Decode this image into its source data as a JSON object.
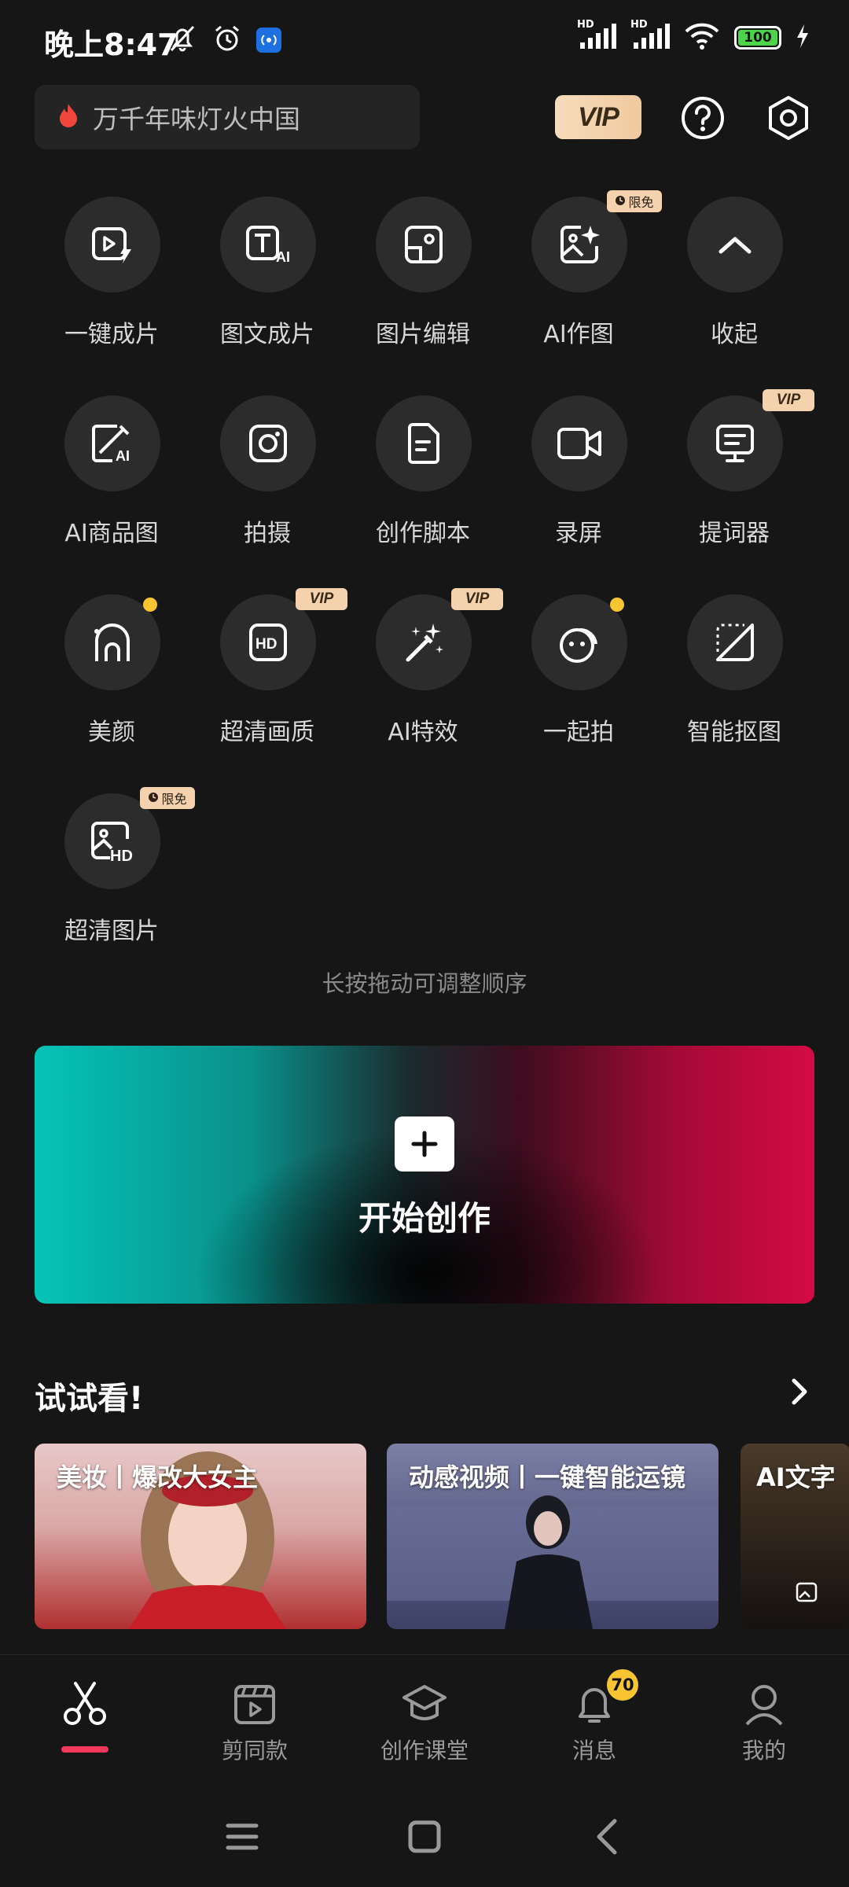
{
  "status_bar": {
    "time": "晚上8:47",
    "network_1": "HD",
    "network_2": "HD",
    "battery": "100"
  },
  "header": {
    "search_text": "万千年味灯火中国",
    "vip_label": "VIP"
  },
  "tools": [
    {
      "label": "一键成片",
      "icon": "play-flash-icon"
    },
    {
      "label": "图文成片",
      "icon": "text-ai-icon"
    },
    {
      "label": "图片编辑",
      "icon": "image-edit-icon"
    },
    {
      "label": "AI作图",
      "icon": "ai-image-icon",
      "tag": "限免"
    },
    {
      "label": "收起",
      "icon": "chevron-up-icon"
    },
    {
      "label": "AI商品图",
      "icon": "ai-product-icon"
    },
    {
      "label": "拍摄",
      "icon": "camera-icon"
    },
    {
      "label": "创作脚本",
      "icon": "script-icon"
    },
    {
      "label": "录屏",
      "icon": "screen-record-icon"
    },
    {
      "label": "提词器",
      "icon": "teleprompter-icon",
      "tag": "VIP"
    },
    {
      "label": "美颜",
      "icon": "beauty-icon"
    },
    {
      "label": "超清画质",
      "icon": "hd-quality-icon",
      "tag": "VIP"
    },
    {
      "label": "AI特效",
      "icon": "magic-wand-icon",
      "tag": "VIP"
    },
    {
      "label": "一起拍",
      "icon": "together-shoot-icon"
    },
    {
      "label": "智能抠图",
      "icon": "cutout-icon"
    },
    {
      "label": "超清图片",
      "icon": "hd-image-icon",
      "tag": "限免"
    }
  ],
  "hint": "长按拖动可调整顺序",
  "create": {
    "label": "开始创作"
  },
  "try_section": {
    "title": "试试看!",
    "cards": [
      {
        "title": "美妆丨爆改大女主"
      },
      {
        "title": "动感视频丨一键智能运镜"
      },
      {
        "title": "AI文字"
      }
    ]
  },
  "bottom_nav": [
    {
      "label": "",
      "icon": "scissors-icon",
      "active": true
    },
    {
      "label": "剪同款",
      "icon": "template-icon"
    },
    {
      "label": "创作课堂",
      "icon": "graduation-cap-icon"
    },
    {
      "label": "消息",
      "icon": "bell-icon",
      "badge": "70"
    },
    {
      "label": "我的",
      "icon": "profile-icon"
    }
  ],
  "colors": {
    "background": "#161616",
    "accent": "#f3385b",
    "vip_gold": "#f3d2ad",
    "badge_yellow": "#f7c531"
  }
}
